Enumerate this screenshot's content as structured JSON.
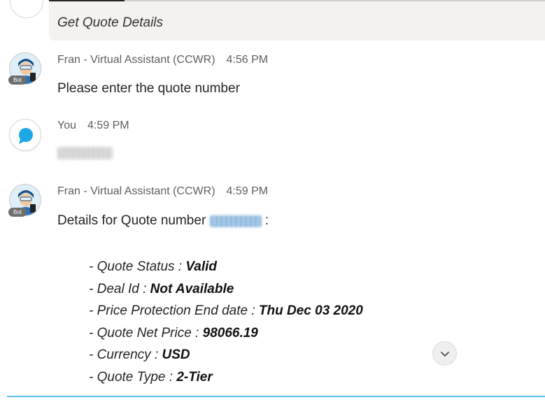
{
  "header": {
    "title": "Get Quote Details"
  },
  "messages": [
    {
      "sender": "Fran - Virtual Assistant (CCWR)",
      "time": "4:56 PM",
      "badge": "Bot",
      "text": "Please enter the quote number"
    },
    {
      "sender": "You",
      "time": "4:59 PM",
      "text": "481156615"
    },
    {
      "sender": "Fran - Virtual Assistant (CCWR)",
      "time": "4:59 PM",
      "badge": "Bot",
      "text": "Details for Quote number",
      "quote_number": "481156615",
      "text_suffix": ":"
    }
  ],
  "details": [
    {
      "label": "- Quote Status : ",
      "value": "Valid"
    },
    {
      "label": "- Deal Id : ",
      "value": "Not Available"
    },
    {
      "label": "- Price Protection End date : ",
      "value": "Thu Dec 03 2020"
    },
    {
      "label": "- Quote Net Price : ",
      "value": "98066.19"
    },
    {
      "label": "- Currency : ",
      "value": "USD"
    },
    {
      "label": "- Quote Type : ",
      "value": "2-Tier"
    }
  ],
  "icons": {
    "scroll": "chevron-down-icon",
    "user": "chat-bubble-icon",
    "bot": "robot-avatar-icon"
  },
  "colors": {
    "accent": "#5bc0ea",
    "user_bubble": "#1ca7e6",
    "header_bg": "#f3f2f1"
  }
}
